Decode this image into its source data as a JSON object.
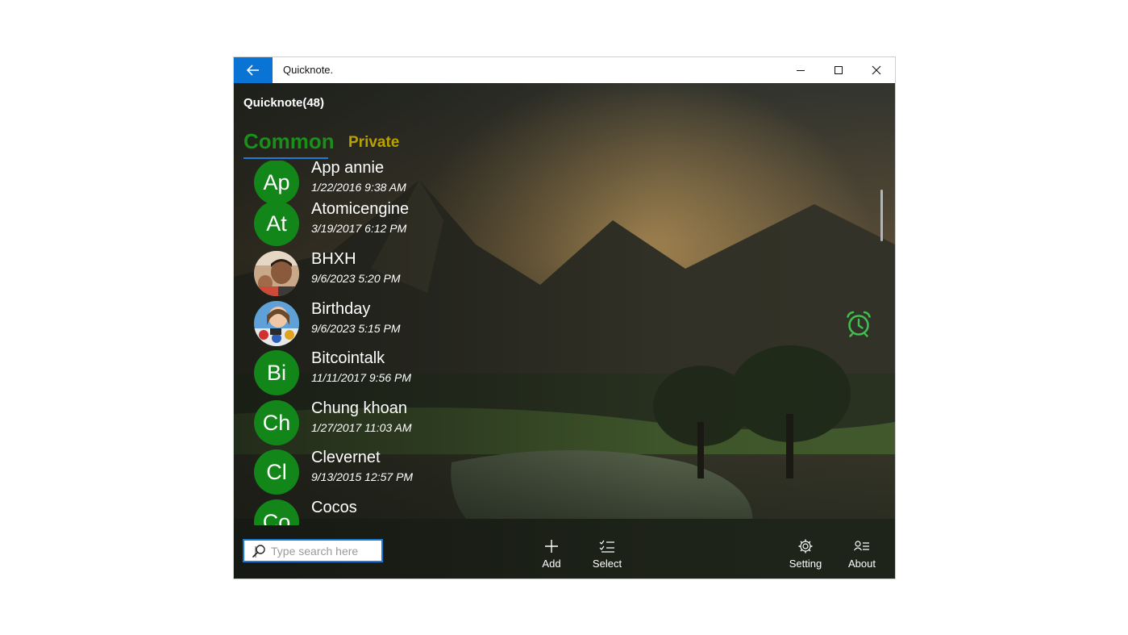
{
  "app": {
    "title": "Quicknote."
  },
  "header": {
    "title": "Quicknote(48)"
  },
  "tabs": [
    {
      "label": "Common"
    },
    {
      "label": "Private"
    }
  ],
  "notes": [
    {
      "avatar_text": "Ap",
      "name": "App annie",
      "date": "1/22/2016 9:38 AM"
    },
    {
      "avatar_text": "At",
      "name": "Atomicengine",
      "date": "3/19/2017 6:12 PM"
    },
    {
      "avatar_text": "",
      "avatar_image": "photo-avatar",
      "name": "BHXH",
      "date": "9/6/2023 5:20 PM"
    },
    {
      "avatar_text": "",
      "avatar_image": "photo-avatar",
      "name": "Birthday",
      "date": "9/6/2023 5:15 PM"
    },
    {
      "avatar_text": "Bi",
      "name": "Bitcointalk",
      "date": "11/11/2017 9:56 PM"
    },
    {
      "avatar_text": "Ch",
      "name": "Chung khoan",
      "date": "1/27/2017 11:03 AM"
    },
    {
      "avatar_text": "Cl",
      "name": "Clevernet",
      "date": "9/13/2015 12:57 PM"
    },
    {
      "avatar_text": "Co",
      "name": "Cocos",
      "date": ""
    }
  ],
  "search": {
    "placeholder": "Type search here",
    "value": ""
  },
  "commands": {
    "add": "Add",
    "select": "Select",
    "setting": "Setting",
    "about": "About"
  },
  "icons": {
    "back": "arrow-left-icon",
    "alarm": "alarm-clock-icon",
    "search": "search-icon",
    "add": "plus-icon",
    "select": "checklist-icon",
    "setting": "gear-icon",
    "about": "contact-list-icon"
  },
  "colors": {
    "accent_blue": "#0a74d4",
    "avatar_green": "#13861a",
    "tab_active": "#1a8f1a",
    "tab_inactive": "#b8a200",
    "alarm_green": "#3fbf4f"
  }
}
